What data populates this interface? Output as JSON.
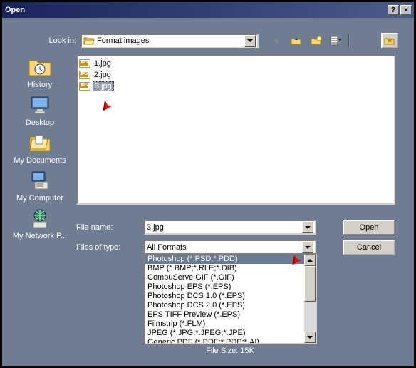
{
  "title": "Open",
  "lookin": {
    "label": "Look in:",
    "value": "Format images"
  },
  "files": [
    {
      "name": "1.jpg",
      "selected": false
    },
    {
      "name": "2.jpg",
      "selected": false
    },
    {
      "name": "3.jpg",
      "selected": true
    }
  ],
  "places": [
    {
      "id": "history",
      "label": "History"
    },
    {
      "id": "desktop",
      "label": "Desktop"
    },
    {
      "id": "mydocs",
      "label": "My Documents"
    },
    {
      "id": "mycomp",
      "label": "My Computer"
    },
    {
      "id": "mynet",
      "label": "My Network P..."
    }
  ],
  "filename": {
    "label": "File name:",
    "value": "3.jpg"
  },
  "filetype": {
    "label": "Files of type:",
    "value": "All Formats"
  },
  "formats": [
    {
      "label": "Photoshop (*.PSD;*.PDD)",
      "selected": true
    },
    {
      "label": "BMP (*.BMP;*.RLE;*.DIB)"
    },
    {
      "label": "CompuServe GIF (*.GIF)"
    },
    {
      "label": "Photoshop EPS (*.EPS)"
    },
    {
      "label": "Photoshop DCS 1.0 (*.EPS)"
    },
    {
      "label": "Photoshop DCS 2.0 (*.EPS)"
    },
    {
      "label": "EPS TIFF Preview (*.EPS)"
    },
    {
      "label": "Filmstrip (*.FLM)"
    },
    {
      "label": "JPEG (*.JPG;*.JPEG;*.JPE)"
    },
    {
      "label": "Generic PDF (*.PDF;*.PDP;*.AI)"
    }
  ],
  "buttons": {
    "open": "Open",
    "cancel": "Cancel"
  },
  "filesize": "File Size: 15K",
  "icons": {
    "history": "🕓",
    "desktop": "🖥",
    "mydocs": "📁",
    "mycomp": "💻",
    "mynet": "🌐",
    "folder": "📂",
    "back": "←",
    "up": "📂",
    "newfolder": "📁",
    "views": "▦",
    "star": "★"
  }
}
